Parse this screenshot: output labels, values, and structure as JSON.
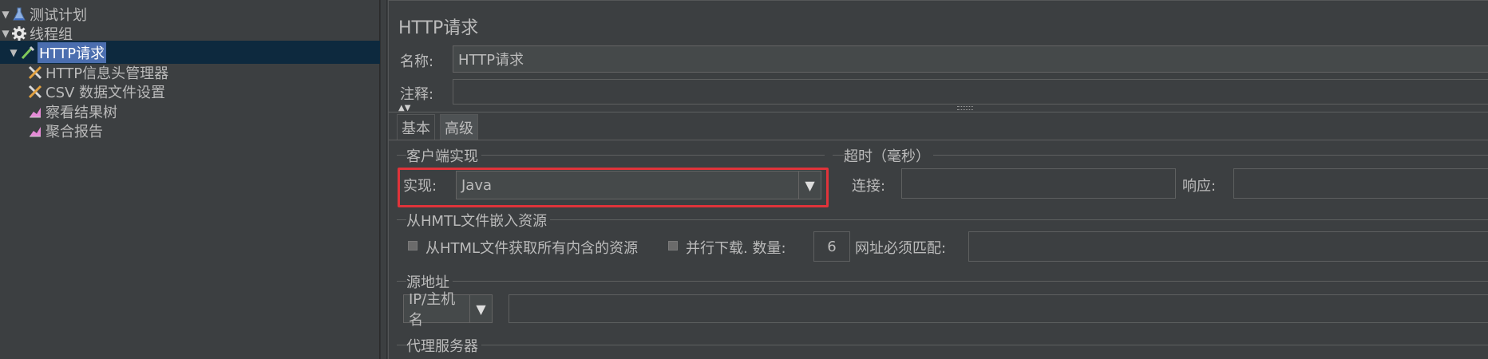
{
  "tree": {
    "items": [
      {
        "label": "测试计划",
        "icon": "flask-icon"
      },
      {
        "label": "线程组",
        "icon": "gear-icon"
      },
      {
        "label": "HTTP请求",
        "icon": "pipette-icon"
      },
      {
        "label": "HTTP信息头管理器",
        "icon": "wrench-icon"
      },
      {
        "label": "CSV 数据文件设置",
        "icon": "wrench-icon"
      },
      {
        "label": "察看结果树",
        "icon": "graph-icon"
      },
      {
        "label": "聚合报告",
        "icon": "graph-icon"
      }
    ]
  },
  "panel": {
    "title": "HTTP请求",
    "name_label": "名称:",
    "name_value": "HTTP请求",
    "comment_label": "注释:",
    "comment_value": "",
    "tabs": [
      {
        "label": "基本"
      },
      {
        "label": "高级"
      }
    ],
    "client_impl": {
      "group_title": "客户端实现",
      "impl_label": "实现:",
      "impl_value": "Java"
    },
    "timeout": {
      "group_title": "超时（毫秒）",
      "connect_label": "连接:",
      "connect_value": "",
      "response_label": "响应:",
      "response_value": ""
    },
    "embedded": {
      "group_title": "从HMTL文件嵌入资源",
      "retrieve_label": "从HTML文件获取所有内含的资源",
      "parallel_label": "并行下载. 数量:",
      "parallel_value": "6",
      "url_match_label": "网址必须匹配:",
      "url_match_value": ""
    },
    "source": {
      "group_title": "源地址",
      "type_value": "IP/主机名",
      "address_value": ""
    },
    "proxy": {
      "group_title": "代理服务器"
    }
  },
  "colors": {
    "selection": "#4b6eaf",
    "highlight_box": "#e0333a"
  }
}
